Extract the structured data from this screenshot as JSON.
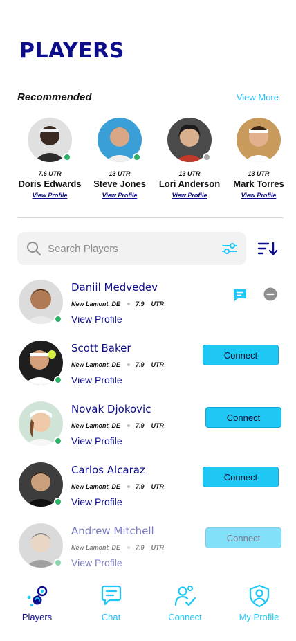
{
  "page_title": "PLAYERS",
  "recommended": {
    "title": "Recommended",
    "view_more": "View More",
    "players": [
      {
        "utr": "7.6  UTR",
        "name": "Doris Edwards",
        "link": "View Profile",
        "online": true
      },
      {
        "utr": "13  UTR",
        "name": "Steve Jones",
        "link": "View Profile",
        "online": true
      },
      {
        "utr": "13  UTR",
        "name": "Lori Anderson",
        "link": "View Profile",
        "online": false
      },
      {
        "utr": "13  UTR",
        "name": "Mark Torres",
        "link": "View Profile",
        "online": false
      }
    ]
  },
  "search": {
    "placeholder": "Search Players"
  },
  "players": [
    {
      "name": "Daniil Medvedev",
      "location": "New Lamont, DE",
      "rating": "7.9",
      "utr_label": "UTR",
      "link": "View Profile",
      "action": "message"
    },
    {
      "name": "Scott Baker",
      "location": "New Lamont, DE",
      "rating": "7.9",
      "utr_label": "UTR",
      "link": "View Profile",
      "action": "Connect"
    },
    {
      "name": "Novak Djokovic",
      "location": "New Lamont, DE",
      "rating": "7.9",
      "utr_label": "UTR",
      "link": "View Profile",
      "action": "Connect"
    },
    {
      "name": "Carlos Alcaraz",
      "location": "New Lamont, DE",
      "rating": "7.9",
      "utr_label": "UTR",
      "link": "View Profile",
      "action": "Connect"
    },
    {
      "name": "Andrew Mitchell",
      "location": "New Lamont, DE",
      "rating": "7.9",
      "utr_label": "UTR",
      "link": "View Profile",
      "action": "Connect"
    }
  ],
  "nav": [
    {
      "label": "Players",
      "icon": "players-icon",
      "active": true
    },
    {
      "label": "Chat",
      "icon": "chat-icon",
      "active": false
    },
    {
      "label": "Connect",
      "icon": "connect-icon",
      "active": false
    },
    {
      "label": "My Profile",
      "icon": "profile-shield-icon",
      "active": false
    }
  ],
  "colors": {
    "brand_navy": "#0d0d8a",
    "accent_cyan": "#1fc7f5",
    "online_green": "#2fb36a",
    "offline_gray": "#a9a9a9"
  }
}
